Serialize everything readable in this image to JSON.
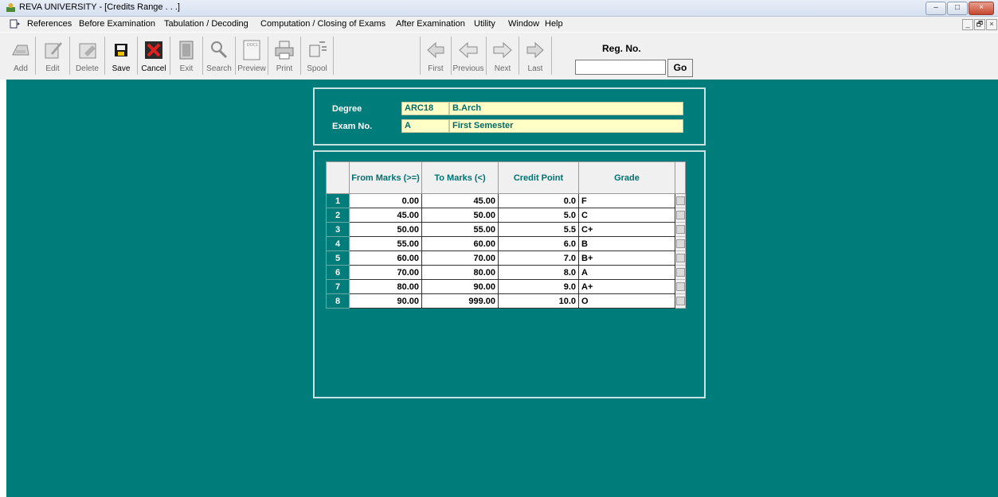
{
  "window": {
    "title": "REVA UNIVERSITY - [Credits Range . . .]",
    "minimize": "–",
    "maximize": "□",
    "close": "×"
  },
  "mdi": {
    "minimize": "_",
    "restore": "🗗",
    "close": "×"
  },
  "menu": [
    "References",
    "Before Examination",
    "Tabulation / Decoding",
    "Computation / Closing of Exams",
    "After Examination",
    "Utility",
    "Window",
    "Help"
  ],
  "toolbar": {
    "add": "Add",
    "edit": "Edit",
    "delete": "Delete",
    "save": "Save",
    "cancel": "Cancel",
    "exit": "Exit",
    "search": "Search",
    "preview": "Preview",
    "print": "Print",
    "spool": "Spool",
    "first": "First",
    "previous": "Previous",
    "next": "Next",
    "last": "Last"
  },
  "regno": {
    "label": "Reg. No.",
    "value": "",
    "go": "Go"
  },
  "form": {
    "degree_label": "Degree",
    "degree_code": "ARC18",
    "degree_name": "B.Arch",
    "exam_label": "Exam No.",
    "exam_code": "A",
    "exam_name": "First Semester"
  },
  "grid": {
    "headers": {
      "from": "From Marks (>=)",
      "to": "To Marks (<)",
      "credit": "Credit Point",
      "grade": "Grade"
    },
    "rows": [
      {
        "n": "1",
        "from": "0.00",
        "to": "45.00",
        "credit": "0.0",
        "grade": "F"
      },
      {
        "n": "2",
        "from": "45.00",
        "to": "50.00",
        "credit": "5.0",
        "grade": "C"
      },
      {
        "n": "3",
        "from": "50.00",
        "to": "55.00",
        "credit": "5.5",
        "grade": "C+"
      },
      {
        "n": "4",
        "from": "55.00",
        "to": "60.00",
        "credit": "6.0",
        "grade": "B"
      },
      {
        "n": "5",
        "from": "60.00",
        "to": "70.00",
        "credit": "7.0",
        "grade": "B+"
      },
      {
        "n": "6",
        "from": "70.00",
        "to": "80.00",
        "credit": "8.0",
        "grade": "A"
      },
      {
        "n": "7",
        "from": "80.00",
        "to": "90.00",
        "credit": "9.0",
        "grade": "A+"
      },
      {
        "n": "8",
        "from": "90.00",
        "to": "999.00",
        "credit": "10.0",
        "grade": "O"
      }
    ]
  },
  "colors": {
    "workspace": "#007c7b",
    "field_bg": "#ffffc6",
    "accent_text": "#007070"
  }
}
